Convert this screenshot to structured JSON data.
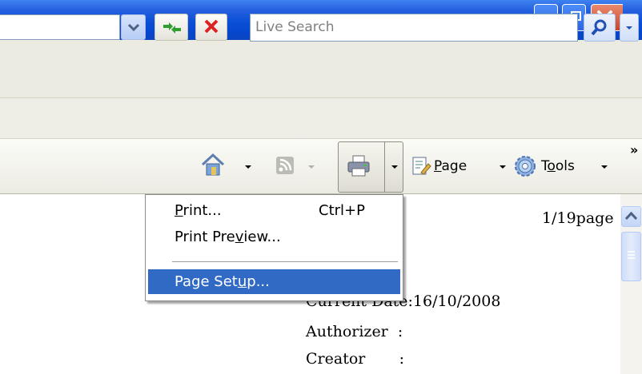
{
  "titlebar": {
    "buttons": [
      "minimize-icon",
      "restore-icon",
      "close-icon"
    ],
    "colors": {
      "bar": "#0a4fd6",
      "close": "#c8462a"
    }
  },
  "address_bar": {
    "search": {
      "placeholder": "Live Search"
    },
    "icons": [
      "dropdown-arrow-icon",
      "refresh-icon",
      "stop-icon",
      "search-icon",
      "search-options-icon"
    ]
  },
  "command_bar": {
    "home_icon": "home-icon",
    "feeds_icon": "feeds-icon",
    "print_icon": "printer-icon",
    "page": {
      "label_pre": "",
      "label_ul": "P",
      "label_post": "age"
    },
    "tools": {
      "label_pre": "T",
      "label_ul": "o",
      "label_post": "ols"
    },
    "overflow": "»"
  },
  "print_menu": {
    "items": [
      {
        "pre": "",
        "ul": "P",
        "post": "rint...",
        "shortcut": "Ctrl+P"
      },
      {
        "pre": "Print Pre",
        "ul": "v",
        "post": "iew...",
        "shortcut": ""
      },
      {
        "pre": "Page Set",
        "ul": "u",
        "post": "p...",
        "shortcut": ""
      }
    ],
    "highlight_color": "#316ac5"
  },
  "document": {
    "page_indicator": "1/19page",
    "current_date": "Current Date:16/10/2008",
    "authorizer": "Authorizer  :",
    "creator": "Creator       :"
  }
}
